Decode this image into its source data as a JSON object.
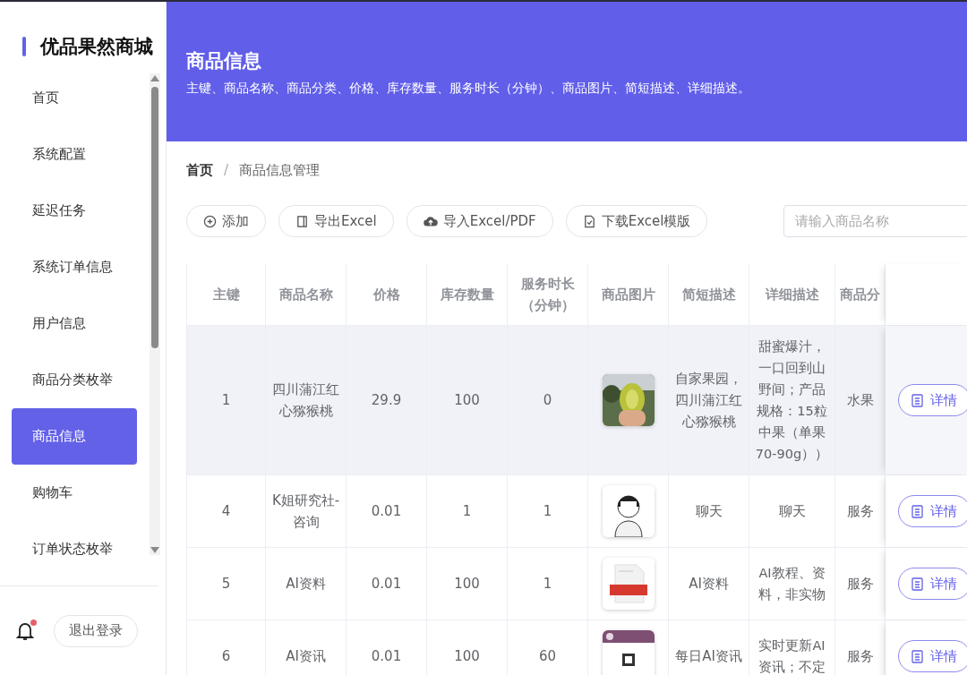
{
  "sidebar": {
    "title": "优品果然商城",
    "items": [
      {
        "label": "首页",
        "selected": false
      },
      {
        "label": "系统配置",
        "selected": false
      },
      {
        "label": "延迟任务",
        "selected": false
      },
      {
        "label": "系统订单信息",
        "selected": false
      },
      {
        "label": "用户信息",
        "selected": false
      },
      {
        "label": "商品分类枚举",
        "selected": false
      },
      {
        "label": "商品信息",
        "selected": true
      },
      {
        "label": "购物车",
        "selected": false
      },
      {
        "label": "订单状态枚举",
        "selected": false
      }
    ],
    "has_notification": true,
    "logout": "退出登录"
  },
  "header": {
    "title": "商品信息",
    "subtitle": "主键、商品名称、商品分类、价格、库存数量、服务时长（分钟）、商品图片、简短描述、详细描述。"
  },
  "breadcrumb": {
    "items": [
      "首页",
      "商品信息管理"
    ],
    "separator": "/"
  },
  "toolbar": {
    "buttons": [
      {
        "label": "添加",
        "kind": "add"
      },
      {
        "label": "导出Excel",
        "kind": "export"
      },
      {
        "label": "导入Excel/PDF",
        "kind": "import"
      },
      {
        "label": "下载Excel模版",
        "kind": "download"
      }
    ],
    "search": {
      "placeholder": "请输入商品名称"
    }
  },
  "table": {
    "columns": [
      "主键",
      "商品名称",
      "价格",
      "库存数量",
      "服务时长（分钟）",
      "商品图片",
      "简短描述",
      "详细描述",
      "商品分"
    ],
    "rows": [
      {
        "highlighted": true,
        "cells": [
          "1",
          "四川蒲江红心猕猴桃",
          "29.9",
          "100",
          "0"
        ],
        "short": "自家果园，四川蒲江红心猕猴桃",
        "detail": "甜蜜爆汁，一口回到山野间；产品规格：15粒中果（单果70-90g））",
        "category": "水果",
        "action": "详情"
      },
      {
        "highlighted": false,
        "cells": [
          "4",
          "K姐研究社-咨询",
          "0.01",
          "1",
          "1"
        ],
        "short": "聊天",
        "detail": "聊天",
        "category": "服务",
        "action": "详情"
      },
      {
        "highlighted": false,
        "cells": [
          "5",
          "AI资料",
          "0.01",
          "100",
          "1"
        ],
        "short": "AI资料",
        "detail": "AI教程、资料，非实物",
        "category": "服务",
        "action": "详情"
      },
      {
        "highlighted": false,
        "cells": [
          "6",
          "AI资讯",
          "0.01",
          "100",
          "60"
        ],
        "short": "每日AI资讯",
        "detail": "实时更新AI资讯；不定",
        "category": "服务",
        "action": "详情"
      }
    ]
  }
}
